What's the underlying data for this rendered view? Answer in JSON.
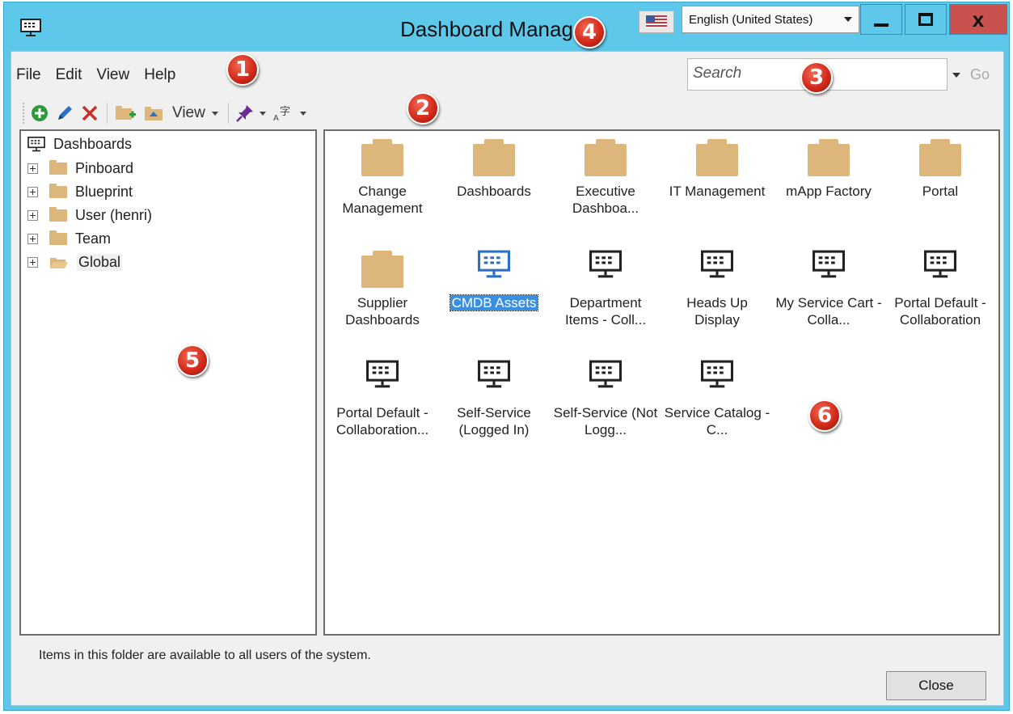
{
  "window": {
    "title": "Dashboard Manager",
    "language": "English (United States)",
    "close_glyph": "x"
  },
  "menu": {
    "items": [
      "File",
      "Edit",
      "View",
      "Help"
    ]
  },
  "search": {
    "placeholder": "Search",
    "go_label": "Go"
  },
  "toolbar": {
    "view_label": "View",
    "icons": [
      "add-icon",
      "edit-icon",
      "delete-icon",
      "new-folder-icon",
      "move-folder-icon",
      "pin-icon",
      "translate-icon"
    ]
  },
  "tree": {
    "root": "Dashboards",
    "items": [
      "Pinboard",
      "Blueprint",
      "User (henri)",
      "Team",
      "Global"
    ],
    "selected": "Global"
  },
  "grid": {
    "items": [
      {
        "type": "folder",
        "label": "Change Management"
      },
      {
        "type": "folder",
        "label": "Dashboards"
      },
      {
        "type": "folder",
        "label": "Executive Dashboa..."
      },
      {
        "type": "folder",
        "label": "IT Management"
      },
      {
        "type": "folder",
        "label": "mApp Factory"
      },
      {
        "type": "folder",
        "label": "Portal"
      },
      {
        "type": "folder",
        "label": "Supplier Dashboards"
      },
      {
        "type": "dashboard",
        "label": "CMDB Assets",
        "selected": true
      },
      {
        "type": "dashboard",
        "label": "Department Items - Coll..."
      },
      {
        "type": "dashboard",
        "label": "Heads Up Display"
      },
      {
        "type": "dashboard",
        "label": "My Service Cart - Colla..."
      },
      {
        "type": "dashboard",
        "label": "Portal Default - Collaboration"
      },
      {
        "type": "dashboard",
        "label": "Portal Default - Collaboration..."
      },
      {
        "type": "dashboard",
        "label": "Self-Service (Logged In)"
      },
      {
        "type": "dashboard",
        "label": "Self-Service (Not Logg..."
      },
      {
        "type": "dashboard",
        "label": "Service Catalog - C..."
      }
    ]
  },
  "status": {
    "text": "Items in this folder are available to all users of the system."
  },
  "buttons": {
    "close": "Close"
  },
  "callouts": [
    "1",
    "2",
    "3",
    "4",
    "5",
    "6"
  ],
  "colors": {
    "titlebar": "#5ec8ea",
    "close_button": "#c9524f",
    "folder": "#dcb67a",
    "selection": "#3b8fe0",
    "callout": "#d42b1b"
  }
}
